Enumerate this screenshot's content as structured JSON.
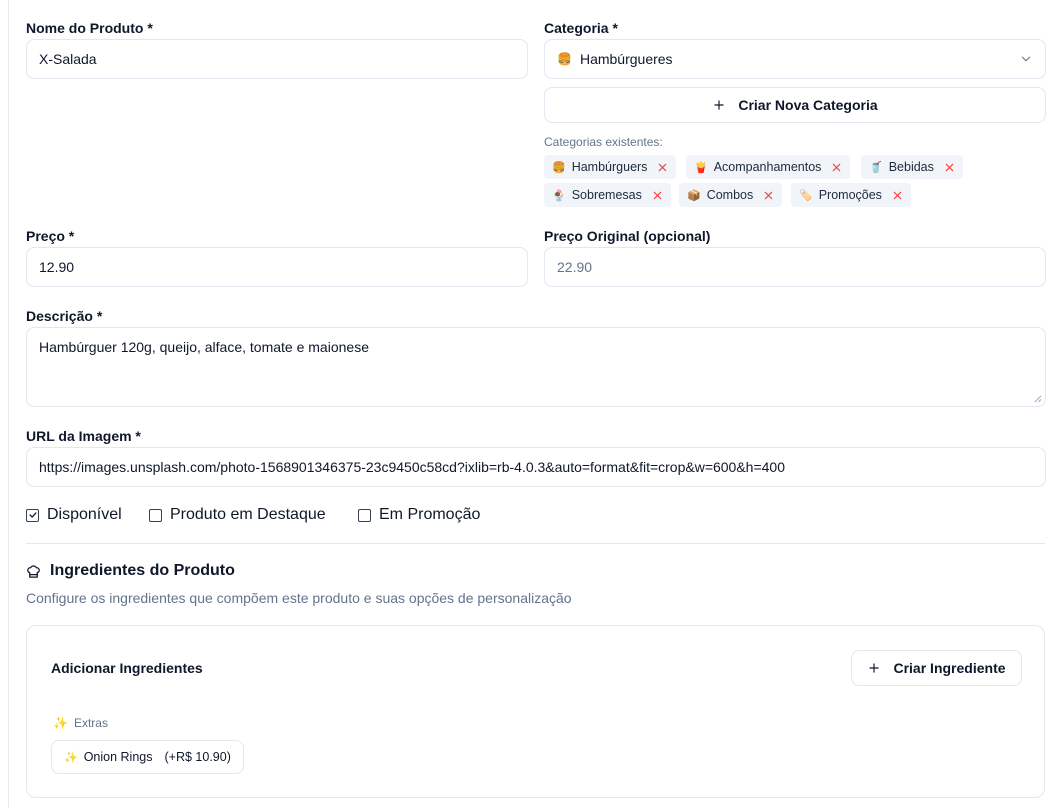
{
  "form": {
    "nome": {
      "label": "Nome do Produto *",
      "value": "X-Salada"
    },
    "categoria": {
      "label": "Categoria *",
      "selected_icon": "🍔",
      "selected": "Hambúrgueres",
      "create_button": "Criar Nova Categoria",
      "existing_label": "Categorias existentes:",
      "existing": [
        {
          "icon": "🍔",
          "label": "Hambúrguers"
        },
        {
          "icon": "🍟",
          "label": "Acompanhamentos"
        },
        {
          "icon": "🥤",
          "label": "Bebidas"
        },
        {
          "icon": "🍨",
          "label": "Sobremesas"
        },
        {
          "icon": "📦",
          "label": "Combos"
        },
        {
          "icon": "🏷️",
          "label": "Promoções"
        }
      ]
    },
    "preco": {
      "label": "Preço *",
      "value": "12.90"
    },
    "preco_original": {
      "label": "Preço Original (opcional)",
      "placeholder": "22.90"
    },
    "descricao": {
      "label": "Descrição *",
      "value": "Hambúrguer 120g, queijo, alface, tomate e maionese"
    },
    "imagem": {
      "label": "URL da Imagem *",
      "value": "https://images.unsplash.com/photo-1568901346375-23c9450c58cd?ixlib=rb-4.0.3&auto=format&fit=crop&w=600&h=400"
    },
    "checkboxes": [
      {
        "label": "Disponível",
        "checked": true
      },
      {
        "label": "Produto em Destaque",
        "checked": false
      },
      {
        "label": "Em Promoção",
        "checked": false
      }
    ]
  },
  "ingredientes": {
    "title": "Ingredientes do Produto",
    "subtitle": "Configure os ingredientes que compõem este produto e suas opções de personalização",
    "card_title": "Adicionar Ingredientes",
    "create_button": "Criar Ingrediente",
    "group": {
      "icon": "✨",
      "label": "Extras"
    },
    "items": [
      {
        "icon": "✨",
        "name": "Onion Rings",
        "price": "(+R$ 10.90)"
      }
    ]
  },
  "colors": {
    "text": "#0f172a",
    "muted": "#64748b",
    "border": "#e2e8f0",
    "chip_bg": "#f1f5f9",
    "remove_x": "#ef4444"
  }
}
